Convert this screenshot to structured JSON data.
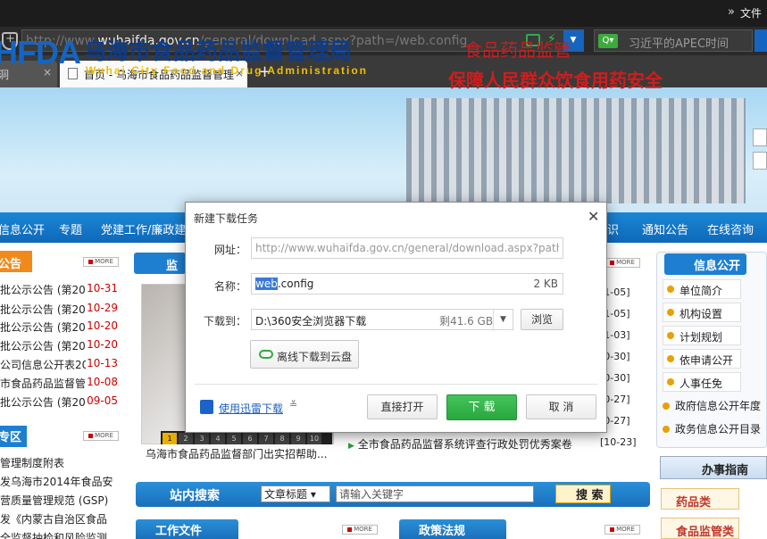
{
  "browser": {
    "top_right_label": "文件",
    "url_prefix": "http://www.",
    "url_domain": "wuhaifda.gov.cn",
    "url_path": "/general/download.aspx?path=/web.config",
    "search_placeholder": "习近平的APEC时间",
    "tabs": [
      {
        "label": "洞"
      },
      {
        "label": "首页 - 乌海市食品药品监督管理局"
      }
    ]
  },
  "site": {
    "logo": "HFDA",
    "name_cn": "乌海市食品药品监督管理局",
    "name_en": "Wuhai City Food and Drug Administration",
    "slogan1": "食品药品监管",
    "slogan2": "保障人民群众饮食用药安全"
  },
  "nav": [
    "信息公开",
    "专题",
    "党建工作/廉政建设",
    "识",
    "通知公告",
    "在线咨询"
  ],
  "left": {
    "notice_title": "公告",
    "notice_items": [
      {
        "text": "批公示公告 (第201",
        "date": "10-31"
      },
      {
        "text": "批公示公告 (第201",
        "date": "10-29"
      },
      {
        "text": "批公示公告 (第201",
        "date": "10-20"
      },
      {
        "text": "批公示公告 (第201",
        "date": "10-20"
      },
      {
        "text": "公司信息公开表2014",
        "date": "10-13"
      },
      {
        "text": "市食品药品监督管理",
        "date": "10-08"
      },
      {
        "text": "批公示公告 (第201",
        "date": "09-05"
      }
    ],
    "topic_title": "专区",
    "topic_items": [
      "管理制度附表",
      "发乌海市2014年食品安",
      "营质量管理规范 (GSP)",
      "发《内蒙古自治区食品",
      "全监督抽检和风险监测"
    ]
  },
  "middle": {
    "section_title": "监",
    "photo_caption": "乌海市食品药品监督部门出实招帮助...",
    "photo_pages": [
      "1",
      "2",
      "3",
      "4",
      "5",
      "6",
      "7",
      "8",
      "9",
      "10"
    ],
    "news_dates": [
      "[1-05]",
      "[1-05]",
      "[1-03]",
      "[0-30]",
      "[0-30]",
      "[0-27]",
      "[0-27]"
    ],
    "last_news": "全市食品药品监督系统评查行政处罚优秀案卷",
    "last_news_date": "[10-23]",
    "more_label": "MORE"
  },
  "right": {
    "info_title": "信息公开",
    "items": [
      "单位简介",
      "机构设置",
      "计划规划",
      "依申请公开",
      "人事任免"
    ],
    "wide_items": [
      "政府信息公开年度",
      "政务信息公开目录"
    ],
    "guide_title": "办事指南",
    "guide_items": [
      "药品类",
      "食品监管类"
    ]
  },
  "site_search": {
    "title": "站内搜索",
    "select_value": "文章标题",
    "placeholder": "请输入关键字",
    "button": "搜 索"
  },
  "bottom": {
    "left_title": "工作文件",
    "right_title": "政策法规"
  },
  "dialog": {
    "title": "新建下载任务",
    "url_label": "网址：",
    "url_value": "http://www.wuhaifda.gov.cn/general/download.aspx?path=",
    "name_label": "名称：",
    "name_selected": "web",
    "name_rest": ".config",
    "size": "2 KB",
    "save_label": "下载到：",
    "save_path": "D:\\360安全浏览器下载",
    "free_space": "剩41.6 GB",
    "browse": "浏览",
    "cloud": "离线下载到云盘",
    "thunder": "使用迅雷下载",
    "open_directly": "直接打开",
    "download": "下 载",
    "cancel": "取 消"
  }
}
